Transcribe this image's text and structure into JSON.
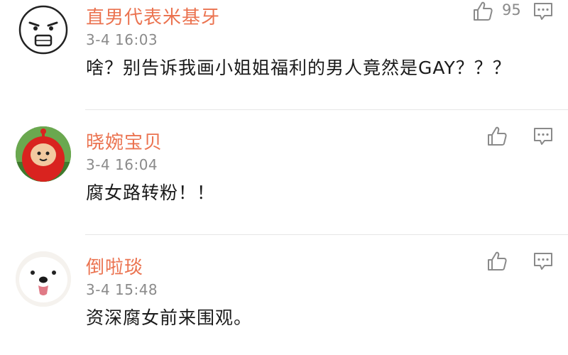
{
  "comments": [
    {
      "username": "直男代表米基牙",
      "time": "3-4  16:03",
      "text": "啥？别告诉我画小姐姐福利的男人竟然是GAY？？？",
      "likes": "95",
      "avatar": "cartoon-face-avatar"
    },
    {
      "username": "晓婉宝贝",
      "time": "3-4  16:04",
      "text": "腐女路转粉！！",
      "likes": "",
      "avatar": "teletubby-avatar"
    },
    {
      "username": "倒啦琰",
      "time": "3-4  15:48",
      "text": "资深腐女前来围观。",
      "likes": "",
      "avatar": "white-dog-avatar"
    }
  ],
  "colors": {
    "username": "#eb7350",
    "meta": "#8a8a8a",
    "text": "#1a1a1a",
    "divider": "#e6e6e6"
  },
  "icons": {
    "like": "thumbs-up-icon",
    "reply": "comment-bubble-icon"
  }
}
